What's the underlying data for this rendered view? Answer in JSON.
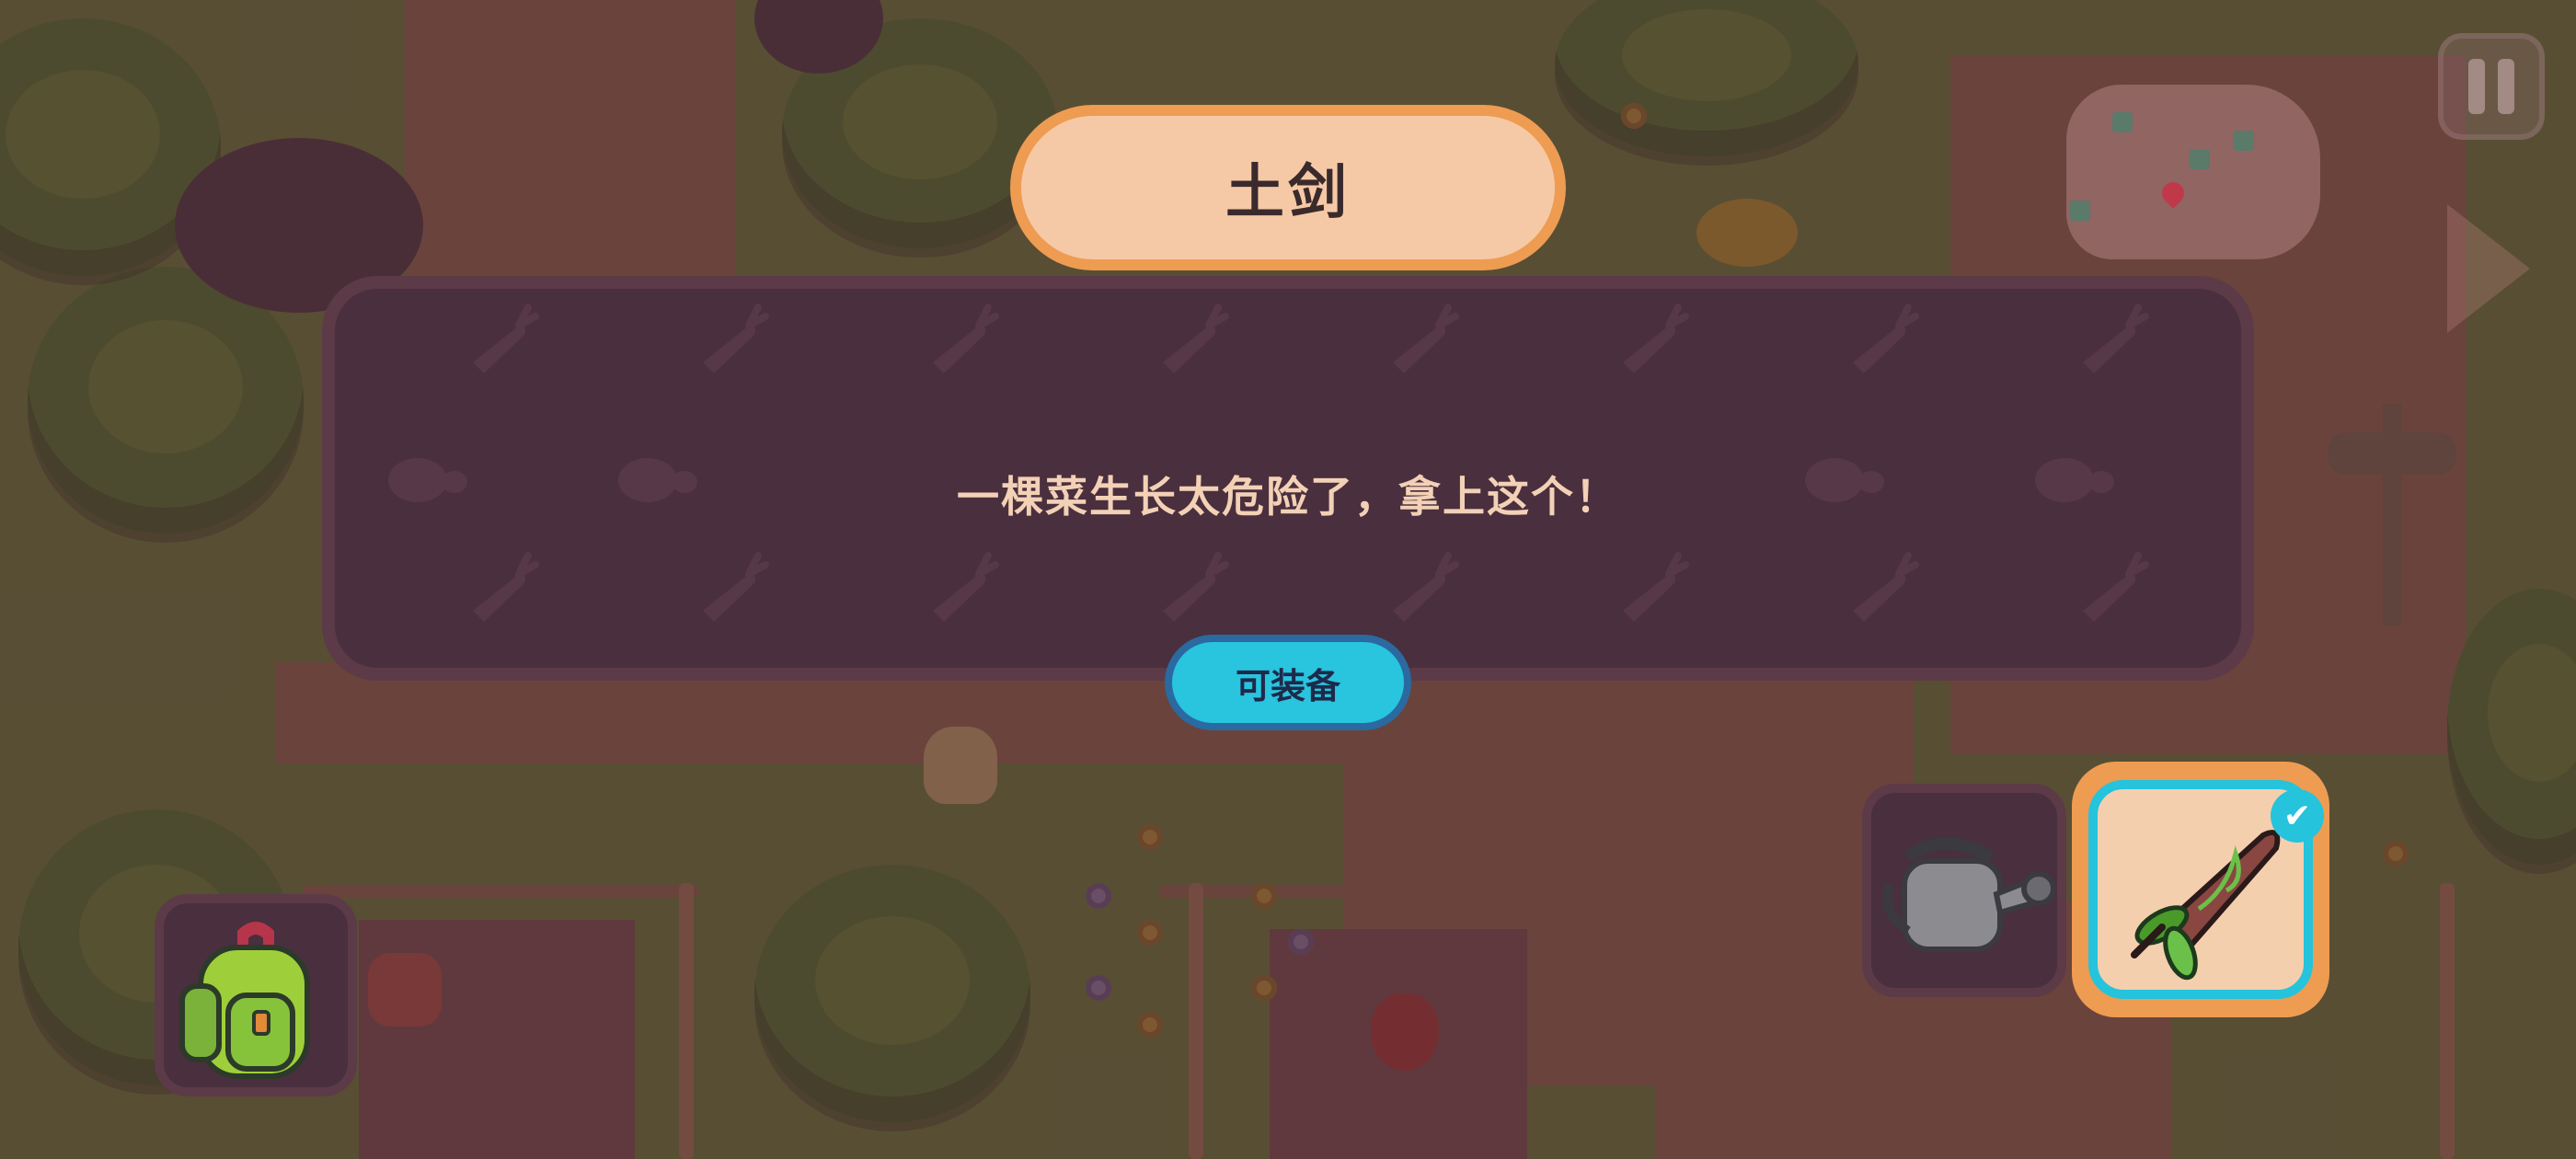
{
  "dialog": {
    "item_name": "土剑",
    "message": "一棵菜生长太危险了，拿上这个！",
    "equip_label": "可装备"
  },
  "hud": {
    "backpack_icon": "backpack-icon",
    "tools": [
      {
        "icon": "watering-can-icon",
        "selected": false
      },
      {
        "icon": "dirt-sword-icon",
        "selected": true
      }
    ],
    "selected_check": "✔",
    "pause_icon": "pause-icon",
    "next_arrow_icon": "arrow-right-icon"
  },
  "colors": {
    "panel": "#4a2f3e",
    "title_plate": "#f6c9a6",
    "title_border": "#ee9c52",
    "button": "#29c4de",
    "selected_border": "#25c3dc"
  }
}
